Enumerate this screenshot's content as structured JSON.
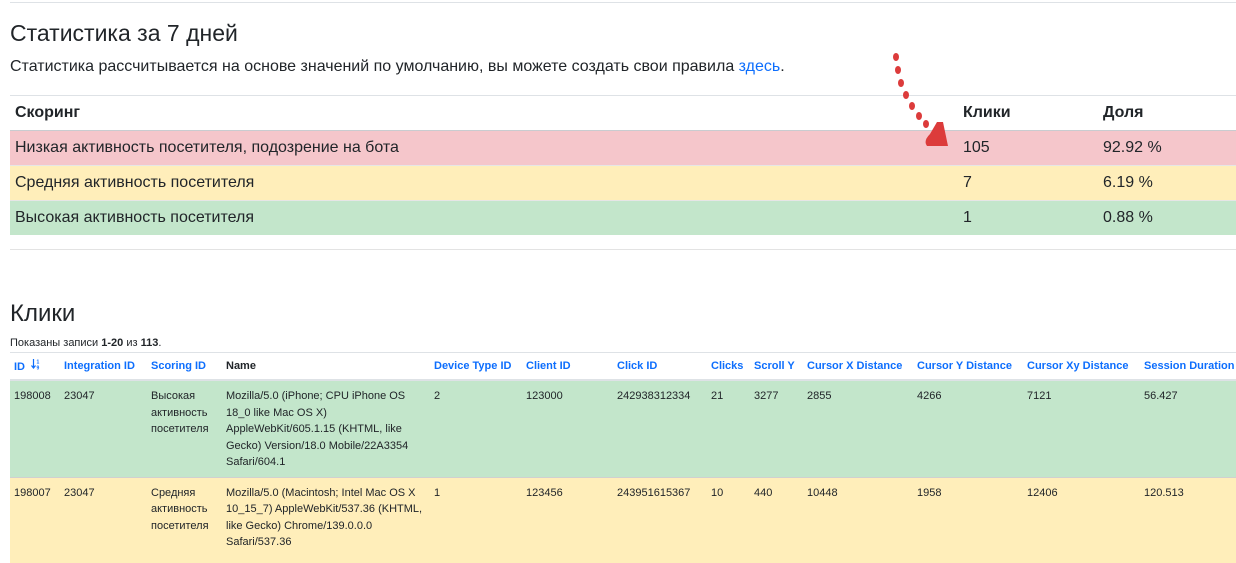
{
  "stats": {
    "title": "Статистика за 7 дней",
    "subtitle_text": "Статистика рассчитывается на основе значений по умолчанию, вы можете создать свои правила ",
    "subtitle_link": "здесь",
    "subtitle_end": ".",
    "headers": {
      "scoring": "Скоринг",
      "clicks": "Клики",
      "share": "Доля"
    },
    "rows": [
      {
        "label": "Низкая активность посетителя, подозрение на бота",
        "clicks": "105",
        "share": "92.92 %"
      },
      {
        "label": "Средняя активность посетителя",
        "clicks": "7",
        "share": "6.19 %"
      },
      {
        "label": "Высокая активность посетителя",
        "clicks": "1",
        "share": "0.88 %"
      }
    ]
  },
  "colors": {
    "low": "#f5c6cb",
    "mid": "#ffeeba",
    "high": "#c3e6cb",
    "link": "#0d6efd",
    "arrow": "#dc3b3b"
  },
  "clicks": {
    "title": "Клики",
    "summary_prefix": "Показаны записи ",
    "summary_range": "1-20",
    "summary_mid": " из ",
    "summary_total": "113",
    "summary_end": ".",
    "sort_icon": "sort-numeric-down-icon",
    "columns": {
      "id": "ID",
      "integration_id": "Integration ID",
      "scoring_id": "Scoring ID",
      "name": "Name",
      "device_type_id": "Device Type ID",
      "client_id": "Client ID",
      "click_id": "Click ID",
      "clicks": "Clicks",
      "scroll_y": "Scroll Y",
      "cursor_x": "Cursor X Distance",
      "cursor_y": "Cursor Y Distance",
      "cursor_xy": "Cursor Xy Distance",
      "session": "Session Duration"
    },
    "rows": [
      {
        "id": "198008",
        "integration_id": "23047",
        "scoring": "Высокая активность посетителя",
        "name": "Mozilla/5.0 (iPhone; CPU iPhone OS 18_0 like Mac OS X) AppleWebKit/605.1.15 (KHTML, like Gecko) Version/18.0 Mobile/22A3354 Safari/604.1",
        "device_type_id": "2",
        "client_id": "123000",
        "click_id": "242938312334",
        "clicks": "21",
        "scroll_y": "3277",
        "cursor_x": "2855",
        "cursor_y": "4266",
        "cursor_xy": "7121",
        "session": "56.427"
      },
      {
        "id": "198007",
        "integration_id": "23047",
        "scoring": "Средняя активность посетителя",
        "name": "Mozilla/5.0 (Macintosh; Intel Mac OS X 10_15_7) AppleWebKit/537.36 (KHTML, like Gecko) Chrome/139.0.0.0 Safari/537.36",
        "device_type_id": "1",
        "client_id": "123456",
        "click_id": "243951615367",
        "clicks": "10",
        "scroll_y": "440",
        "cursor_x": "10448",
        "cursor_y": "1958",
        "cursor_xy": "12406",
        "session": "120.513"
      }
    ]
  }
}
